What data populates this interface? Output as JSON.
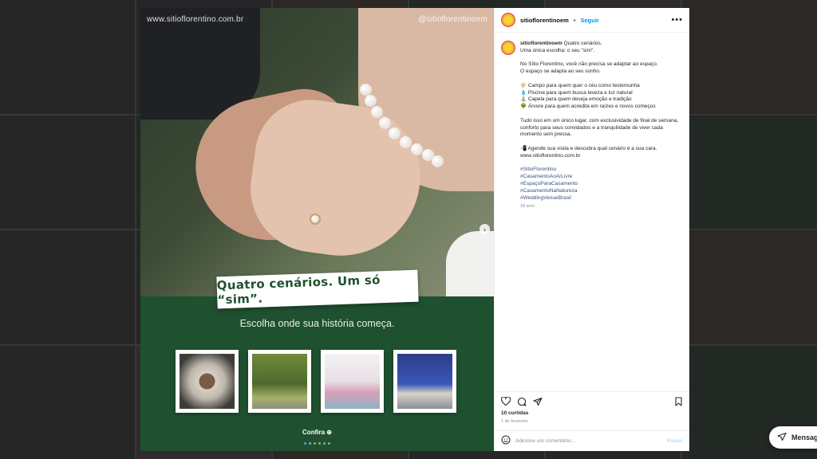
{
  "media": {
    "watermark_left": "www.sitioflorentino.com.br",
    "watermark_right": "@sitioflorentinoem",
    "headline": "Quatro cenários. Um só “sim”.",
    "subtitle": "Escolha onde sua história começa.",
    "cta": "Confira ⊕",
    "slide_count": 6,
    "active_slide": 1,
    "brand_green": "#1f5130"
  },
  "header": {
    "username": "sitioflorentinoem",
    "separator": "•",
    "follow_label": "Seguir",
    "more_icon": "more-horizontal-icon"
  },
  "caption": {
    "username": "sitioflorentinoem",
    "intro": "Quatro cenários.",
    "line2": "Uma única escolha: o seu \"sim\".",
    "para2_line1": "No Sítio Florentino, você não precisa se adaptar ao espaço.",
    "para2_line2": "O espaço se adapta ao seu sonho.",
    "items": [
      "🌾 Campo para quem quer o céu como testemunha",
      "💧 Piscina para quem busca leveza e luz natural",
      "⛪ Capela para quem deseja emoção e tradição",
      "🌳 Árvore para quem acredita em raízes e novos começos"
    ],
    "para4": "Tudo isso em um único lugar, com exclusividade de final de semana, conforto para seus convidados e a tranquilidade de viver cada momento sem pressa.",
    "cta_line": "📲 Agende sua visita e descubra qual cenário é a sua cara.",
    "url": "www.sitioflorentino.com.br",
    "hashtags": [
      "#SitioFlorentino",
      "#CasamentoAoArLivre",
      "#EspaçoParaCasamento",
      "#CasamentoNaNatureza",
      "#WeddingVenueBrasil"
    ],
    "age": "18 sem"
  },
  "footer": {
    "likes": "10 curtidas",
    "date": "1 de fevereiro",
    "comment_placeholder": "Adicione um comentário...",
    "post_label": "Postar"
  },
  "messages": {
    "label": "Mensagens"
  }
}
